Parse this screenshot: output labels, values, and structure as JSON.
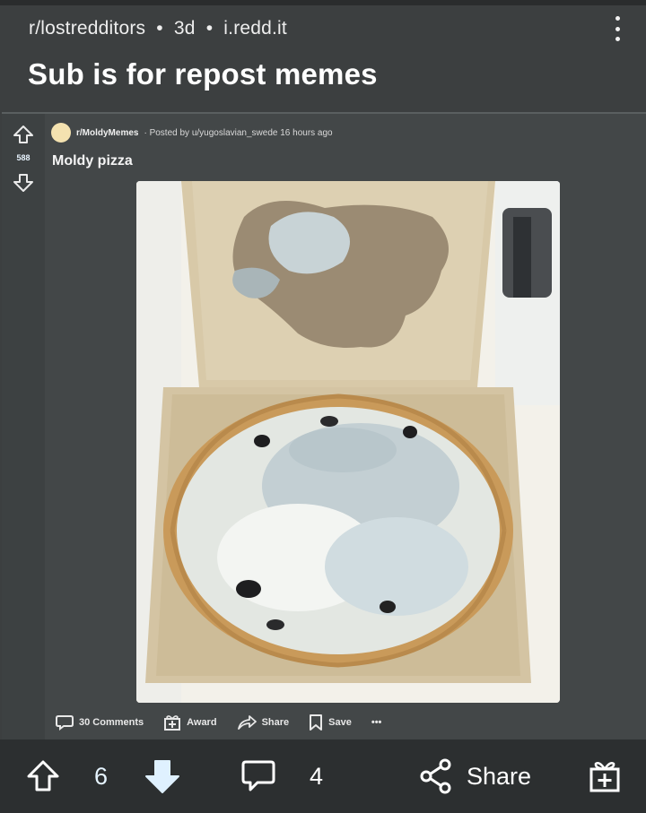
{
  "post": {
    "subreddit": "r/lostredditors",
    "age": "3d",
    "domain": "i.redd.it",
    "separator": "•",
    "title": "Sub is for repost memes"
  },
  "embedded_post": {
    "score": "588",
    "subreddit": "r/MoldyMemes",
    "byline": "· Posted by u/yugoslavian_swede 16 hours ago",
    "title": "Moldy pizza",
    "actions": {
      "comments": "30 Comments",
      "award": "Award",
      "share": "Share",
      "save": "Save",
      "more": "•••"
    }
  },
  "bottom_bar": {
    "vote_count": "6",
    "comment_count": "4",
    "share_label": "Share"
  },
  "colors": {
    "background": "#3c3f40",
    "bottom_bar": "#2c2f30",
    "downvote_active": "#dff1ff"
  }
}
